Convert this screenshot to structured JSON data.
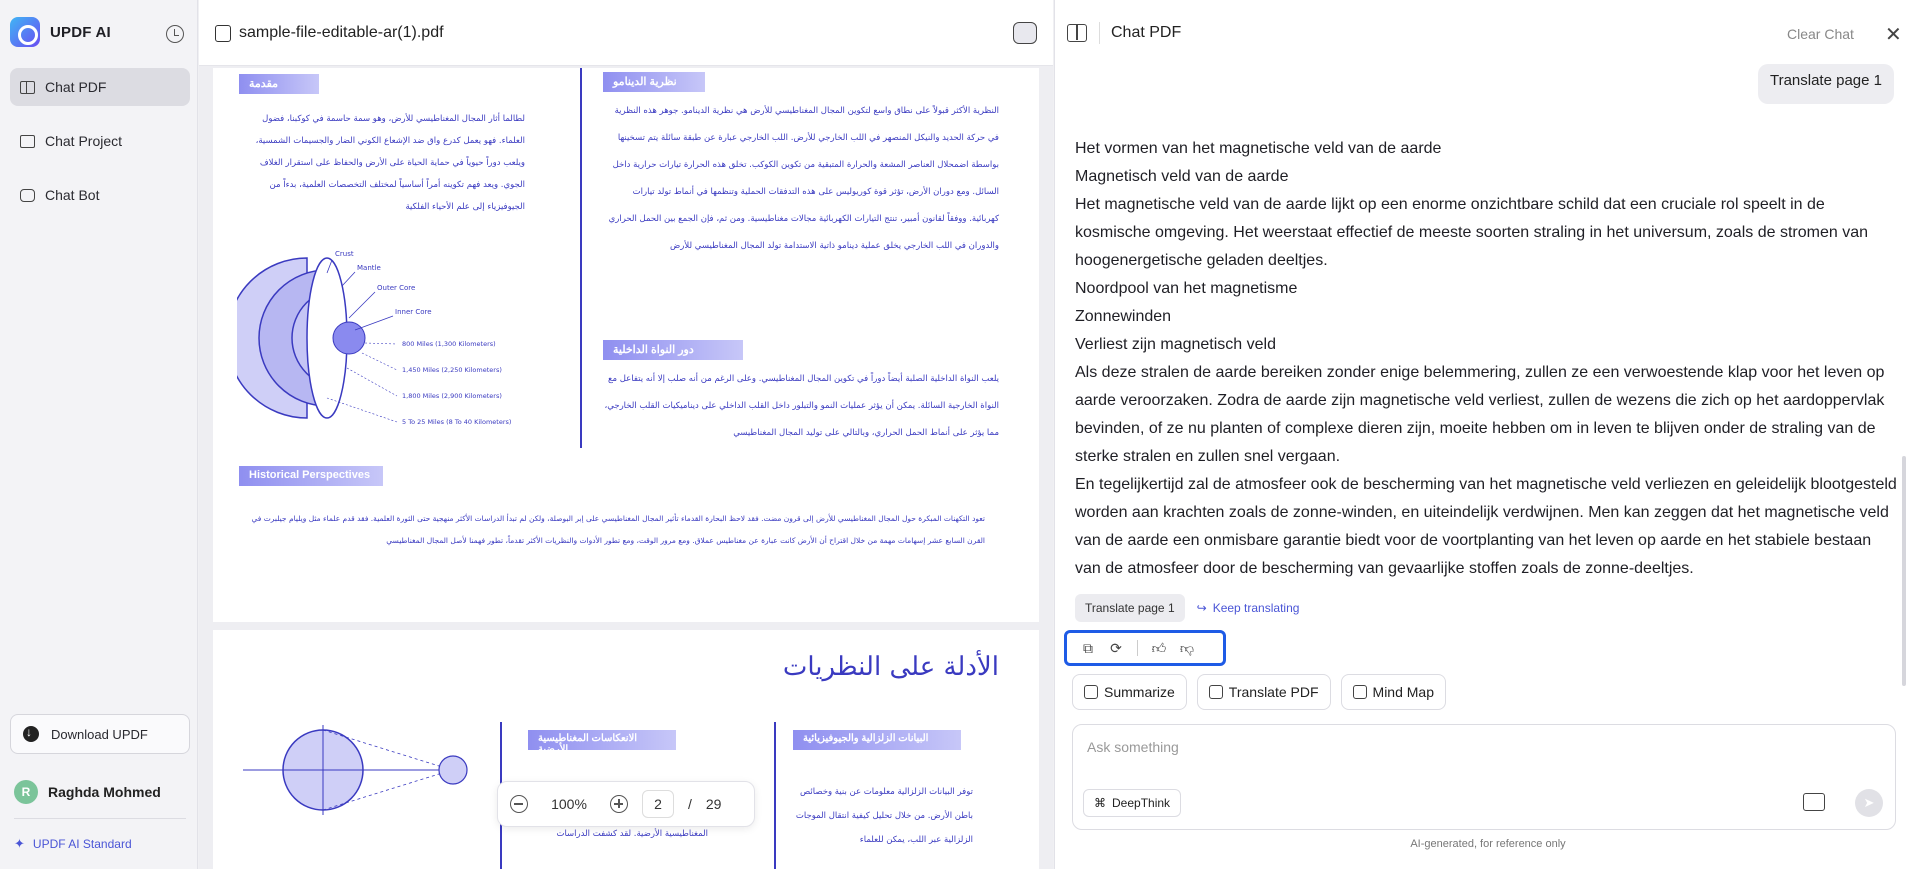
{
  "sidebar": {
    "brand": "UPDF AI",
    "items": [
      {
        "label": "Chat PDF",
        "active": true
      },
      {
        "label": "Chat Project",
        "active": false
      },
      {
        "label": "Chat Bot",
        "active": false
      }
    ],
    "download_label": "Download UPDF",
    "user_initial": "R",
    "user_name": "Raghda Mohmed",
    "plan_label": "UPDF AI Standard"
  },
  "viewer": {
    "file_name": "sample-file-editable-ar(1).pdf",
    "page1": {
      "heading_intro": "مقدمة",
      "heading_dynamo": "نظرية الدينامو",
      "heading_core": "دور النواة الداخلية",
      "heading_history": "Historical Perspectives",
      "intro_text": "لطالما أثار المجال المغناطيسي للأرض، وهو سمة حاسمة في كوكبنا، فضول العلماء. فهو يعمل كدرع واق ضد الإشعاع الكوني الضار والجسيمات الشمسية، ويلعب دوراً حيوياً في حماية الحياة على الأرض والحفاظ على استقرار الغلاف الجوي. ويعد فهم تكوينه أمراً أساسياً لمختلف التخصصات العلمية، بدءاً من الجيوفيزياء إلى علم الأحياء الفلكية",
      "dynamo_text": "النظرية الأكثر قبولاً على نطاق واسع لتكوين المجال المغناطيسي للأرض هي نظرية الدينامو. جوهر هذه النظرية في حركة الحديد والنيكل المنصهر في اللب الخارجي للأرض. اللب الخارجي عبارة عن طبقة سائلة يتم تسخينها بواسطة اضمحلال العناصر المشعة والحرارة المتبقية من تكوين الكوكب. تخلق هذه الحرارة تيارات حرارية داخل السائل. ومع دوران الأرض، تؤثر قوة كوريوليس على هذه التدفقات الحملية وتنظمها في أنماط تولد تيارات كهربائية. ووفقاً لقانون أمبير، تنتج التيارات الكهربائية مجالات مغناطيسية. ومن ثم، فإن الجمع بين الحمل الحراري والدوران في اللب الخارجي يخلق عملية دينامو ذاتية الاستدامة تولد المجال المغناطيسي للأرض",
      "core_text": "يلعب النواة الداخلية الصلبة أيضاً دوراً في تكوين المجال المغناطيسي. وعلى الرغم من أنه صلب إلا أنه يتفاعل مع النواة الخارجية السائلة. يمكن أن يؤثر عمليات النمو والتبلور داخل القلب الداخلي على ديناميكيات القلب الخارجي، مما يؤثر على أنماط الحمل الحراري، وبالتالي على توليد المجال المغناطيسي",
      "history_text": "تعود التكهنات المبكرة حول المجال المغناطيسي للأرض إلى قرون مضت. فقد لاحظ البحارة القدماء تأثير المجال المغناطيسي على إبر البوصلة، ولكن لم تبدأ الدراسات الأكثر منهجية حتى الثورة العلمية. فقد قدم علماء مثل ويليام جيلبرت في القرن السابع عشر إسهامات مهمة من خلال اقتراح أن الأرض كانت عبارة عن مغناطيس عملاق. ومع مرور الوقت، ومع تطور الأدوات والنظريات الأكثر تقدماً، تطور فهمنا لأصل المجال المغناطيسي",
      "diagram_labels": {
        "crust": "Crust",
        "mantle": "Mantle",
        "outer_core": "Outer Core",
        "inner_core": "Inner Core",
        "d1": "800 Miles (1,300 Kilometers)",
        "d2": "1,450 Miles (2,250 Kilometers)",
        "d3": "1,800 Miles (2,900 Kilometers)",
        "d4": "5 To 25 Miles (8 To 40 Kilometers)"
      }
    },
    "page2": {
      "heading": "الأدلة على النظريات",
      "heading_geo": "البيانات الزلزالية والجيوفيزيائية",
      "heading_reflect": "الانعكاسات المغناطيسية الأرضية",
      "geo_text": "توفر البيانات الزلزالية معلومات عن بنية وخصائص باطن الأرض. من خلال تحليل كيفية انتقال الموجات الزلزالية عبر اللب، يمكن للعلماء",
      "reflect_text": "المغناطيسية الأرضية. لقد كشفت الدراسات"
    },
    "zoom": "100%",
    "current_page": "2",
    "page_sep": "/",
    "total_pages": "29"
  },
  "chat": {
    "title": "Chat PDF",
    "clear_label": "Clear Chat",
    "user_message": "Translate page 1",
    "answer_lines": [
      "Het vormen van het magnetische veld van de aarde",
      "Magnetisch veld van de aarde",
      "Het magnetische veld van de aarde lijkt op een enorme onzichtbare schild dat een cruciale rol speelt in de kosmische omgeving. Het weerstaat effectief de meeste soorten straling in het universum, zoals de stromen van hoogenergetische geladen deeltjes.",
      "Noordpool van het magnetisme",
      "Zonnewinden",
      "Verliest zijn magnetisch veld",
      "Als deze stralen de aarde bereiken zonder enige belemmering, zullen ze een verwoestende klap voor het leven op aarde veroorzaken. Zodra de aarde zijn magnetische veld verliest, zullen de wezens die zich op het aardoppervlak bevinden, of ze nu planten of complexe dieren zijn, moeite hebben om in leven te blijven onder de straling van de sterke stralen en zullen snel vergaan.",
      "En tegelijkertijd zal de atmosfeer ook de bescherming van het magnetische veld verliezen en geleidelijk blootgesteld worden aan krachten zoals de zonne-winden, en uiteindelijk verdwijnen. Men kan zeggen dat het magnetische veld van de aarde een onmisbare garantie biedt voor de voortplanting van het leven op aarde en het stabiele bestaan van de atmosfeer door de bescherming van gevaarlijke stoffen zoals de zonne-deeltjes."
    ],
    "followup_chip": "Translate page 1",
    "keep_translating": "Keep translating",
    "tools": [
      "Summarize",
      "Translate PDF",
      "Mind Map"
    ],
    "input_placeholder": "Ask something",
    "deepthink_label": "DeepThink",
    "disclaimer": "AI-generated, for reference only"
  },
  "colors": {
    "accent": "#4a55d6",
    "highlight_border": "#1e5be6",
    "pdf_text": "#3a3ac0"
  }
}
